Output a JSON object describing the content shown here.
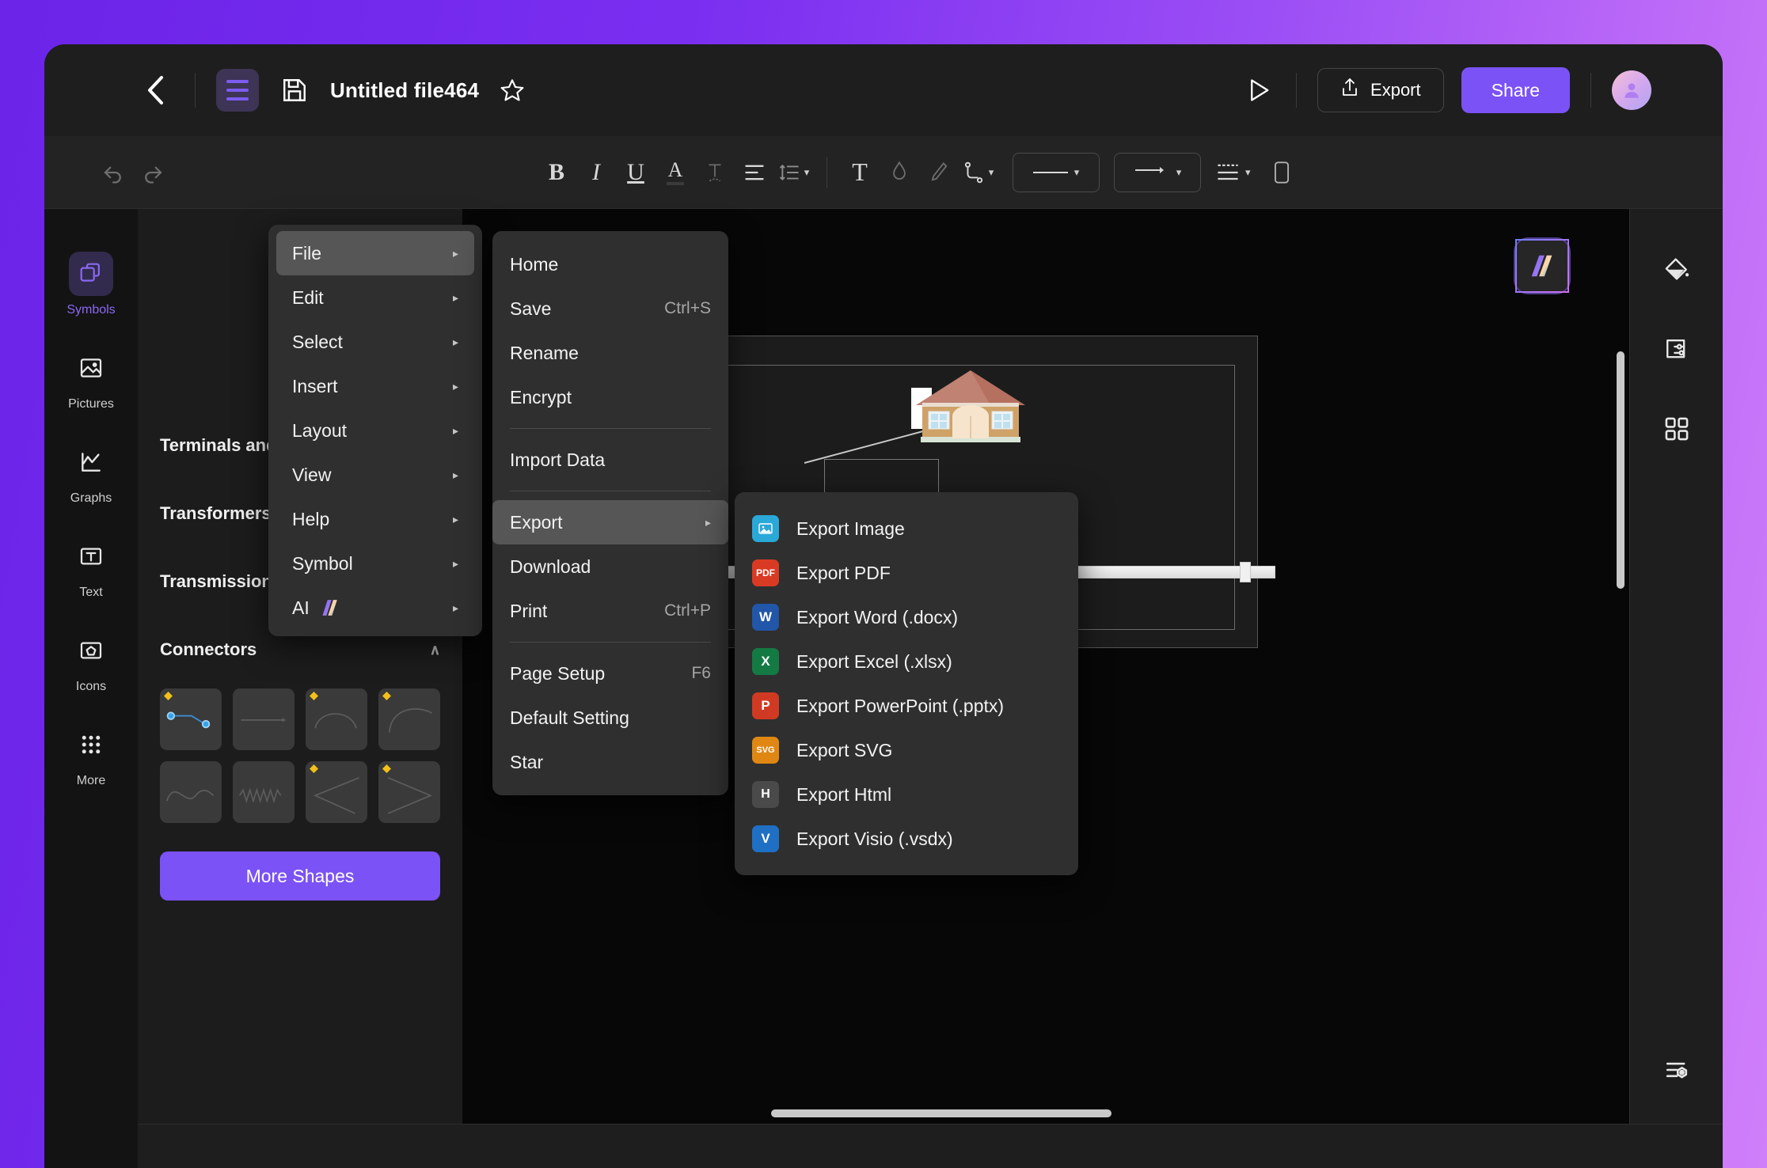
{
  "header": {
    "back_icon": "chevron-left-icon",
    "menu_icon": "hamburger-icon",
    "save_icon": "floppy-save-icon",
    "title": "Untitled file464",
    "star_icon": "star-icon",
    "play_icon": "play-presentation-icon",
    "export_label": "Export",
    "export_icon": "share-upload-icon",
    "share_label": "Share",
    "avatar_icon": "user-avatar"
  },
  "toolbar": {
    "items": [
      {
        "name": "undo-icon",
        "glyph": "↶"
      },
      {
        "name": "redo-icon",
        "glyph": "↷"
      },
      {
        "name": "bold-icon",
        "glyph": "B"
      },
      {
        "name": "italic-icon",
        "glyph": "I"
      },
      {
        "name": "underline-icon",
        "glyph": "U"
      },
      {
        "name": "font-color-icon",
        "glyph": "A"
      },
      {
        "name": "text-shadow-icon",
        "glyph": "T"
      },
      {
        "name": "align-icon",
        "glyph": "≡"
      },
      {
        "name": "line-spacing-icon",
        "glyph": "☰"
      },
      {
        "name": "text-box-icon",
        "glyph": "T"
      },
      {
        "name": "fill-color-icon",
        "glyph": "◇"
      },
      {
        "name": "line-style-icon",
        "glyph": "╱"
      },
      {
        "name": "connector-type-icon",
        "glyph": "⤵"
      },
      {
        "name": "line-weight-icon",
        "glyph": "—"
      },
      {
        "name": "arrow-style-icon",
        "glyph": "⟶"
      },
      {
        "name": "dash-style-icon",
        "glyph": "═"
      },
      {
        "name": "shape-format-icon",
        "glyph": "▢"
      }
    ]
  },
  "left_rail": {
    "items": [
      {
        "label": "Symbols",
        "icon": "symbols-icon",
        "active": true
      },
      {
        "label": "Pictures",
        "icon": "pictures-icon",
        "active": false
      },
      {
        "label": "Graphs",
        "icon": "graphs-icon",
        "active": false
      },
      {
        "label": "Text",
        "icon": "text-icon",
        "active": false
      },
      {
        "label": "Icons",
        "icon": "icons-icon",
        "active": false
      },
      {
        "label": "More",
        "icon": "more-grid-icon",
        "active": false
      }
    ]
  },
  "shapes_panel": {
    "sections": [
      {
        "label": "Terminals and Conn..",
        "chevron": ""
      },
      {
        "label": "Transformers and W.",
        "chevron": ""
      },
      {
        "label": "Transmission Path",
        "chevron": "∨"
      },
      {
        "label": "Connectors",
        "chevron": "∧"
      }
    ],
    "connector_cells": [
      {
        "name": "elbow-connector",
        "badge": true,
        "selected": true
      },
      {
        "name": "straight-connector",
        "badge": false,
        "selected": false
      },
      {
        "name": "arc-connector",
        "badge": true,
        "selected": false
      },
      {
        "name": "curve-connector",
        "badge": true,
        "selected": false
      },
      {
        "name": "wave-connector",
        "badge": false,
        "selected": false
      },
      {
        "name": "zigzag-connector",
        "badge": false,
        "selected": false
      },
      {
        "name": "angle-left-connector",
        "badge": true,
        "selected": false
      },
      {
        "name": "angle-right-connector",
        "badge": true,
        "selected": false
      }
    ],
    "more_shapes_label": "More Shapes"
  },
  "menu_level1": {
    "items": [
      {
        "label": "File",
        "arrow": "▸",
        "selected": true
      },
      {
        "label": "Edit",
        "arrow": "▸",
        "selected": false
      },
      {
        "label": "Select",
        "arrow": "▸",
        "selected": false
      },
      {
        "label": "Insert",
        "arrow": "▸",
        "selected": false
      },
      {
        "label": "Layout",
        "arrow": "▸",
        "selected": false
      },
      {
        "label": "View",
        "arrow": "▸",
        "selected": false
      },
      {
        "label": "Help",
        "arrow": "▸",
        "selected": false
      },
      {
        "label": "Symbol",
        "arrow": "▸",
        "selected": false
      },
      {
        "label": "AI",
        "arrow": "▸",
        "selected": false,
        "ai_mark": true
      }
    ]
  },
  "menu_level2": {
    "items": [
      {
        "label": "Home",
        "shortcut": "",
        "arrow": "",
        "selected": false,
        "sep_after": false
      },
      {
        "label": "Save",
        "shortcut": "Ctrl+S",
        "arrow": "",
        "selected": false,
        "sep_after": false
      },
      {
        "label": "Rename",
        "shortcut": "",
        "arrow": "",
        "selected": false,
        "sep_after": false
      },
      {
        "label": "Encrypt",
        "shortcut": "",
        "arrow": "",
        "selected": false,
        "sep_after": true
      },
      {
        "label": "Import Data",
        "shortcut": "",
        "arrow": "",
        "selected": false,
        "sep_after": true
      },
      {
        "label": "Export",
        "shortcut": "",
        "arrow": "▸",
        "selected": true,
        "sep_after": false
      },
      {
        "label": "Download",
        "shortcut": "",
        "arrow": "",
        "selected": false,
        "sep_after": false
      },
      {
        "label": "Print",
        "shortcut": "Ctrl+P",
        "arrow": "",
        "selected": false,
        "sep_after": true
      },
      {
        "label": "Page Setup",
        "shortcut": "F6",
        "arrow": "",
        "selected": false,
        "sep_after": false
      },
      {
        "label": "Default Setting",
        "shortcut": "",
        "arrow": "",
        "selected": false,
        "sep_after": false
      },
      {
        "label": "Star",
        "shortcut": "",
        "arrow": "",
        "selected": false,
        "sep_after": false
      }
    ]
  },
  "menu_level3": {
    "items": [
      {
        "label": "Export Image",
        "icon": "image-file-icon",
        "glyph": "⛰",
        "color": "#2aa8d8"
      },
      {
        "label": "Export PDF",
        "icon": "pdf-file-icon",
        "glyph": "PDF",
        "color": "#d93a23"
      },
      {
        "label": "Export Word (.docx)",
        "icon": "word-file-icon",
        "glyph": "W",
        "color": "#2156a8"
      },
      {
        "label": "Export Excel (.xlsx)",
        "icon": "excel-file-icon",
        "glyph": "X",
        "color": "#147a43"
      },
      {
        "label": "Export PowerPoint (.pptx)",
        "icon": "powerpoint-file-icon",
        "glyph": "P",
        "color": "#d03a22"
      },
      {
        "label": "Export SVG",
        "icon": "svg-file-icon",
        "glyph": "SVG",
        "color": "#e08713"
      },
      {
        "label": "Export Html",
        "icon": "html-file-icon",
        "glyph": "H",
        "color": "#4a4a4a"
      },
      {
        "label": "Export Visio (.vsdx)",
        "icon": "visio-file-icon",
        "glyph": "V",
        "color": "#1f6fc4"
      }
    ]
  },
  "right_rail": {
    "items": [
      {
        "name": "fill-bucket-icon"
      },
      {
        "name": "page-settings-icon"
      },
      {
        "name": "grid-layout-icon"
      }
    ],
    "bottom": {
      "name": "list-settings-icon"
    }
  },
  "canvas": {
    "ai_badge": "ai-assistant-badge",
    "shapes": [
      {
        "name": "house-shape"
      },
      {
        "name": "white-terminal-shape"
      },
      {
        "name": "rectangle-shape"
      },
      {
        "name": "green-box-shape"
      },
      {
        "name": "horizontal-bar-shape"
      },
      {
        "name": "connector-line"
      }
    ]
  }
}
